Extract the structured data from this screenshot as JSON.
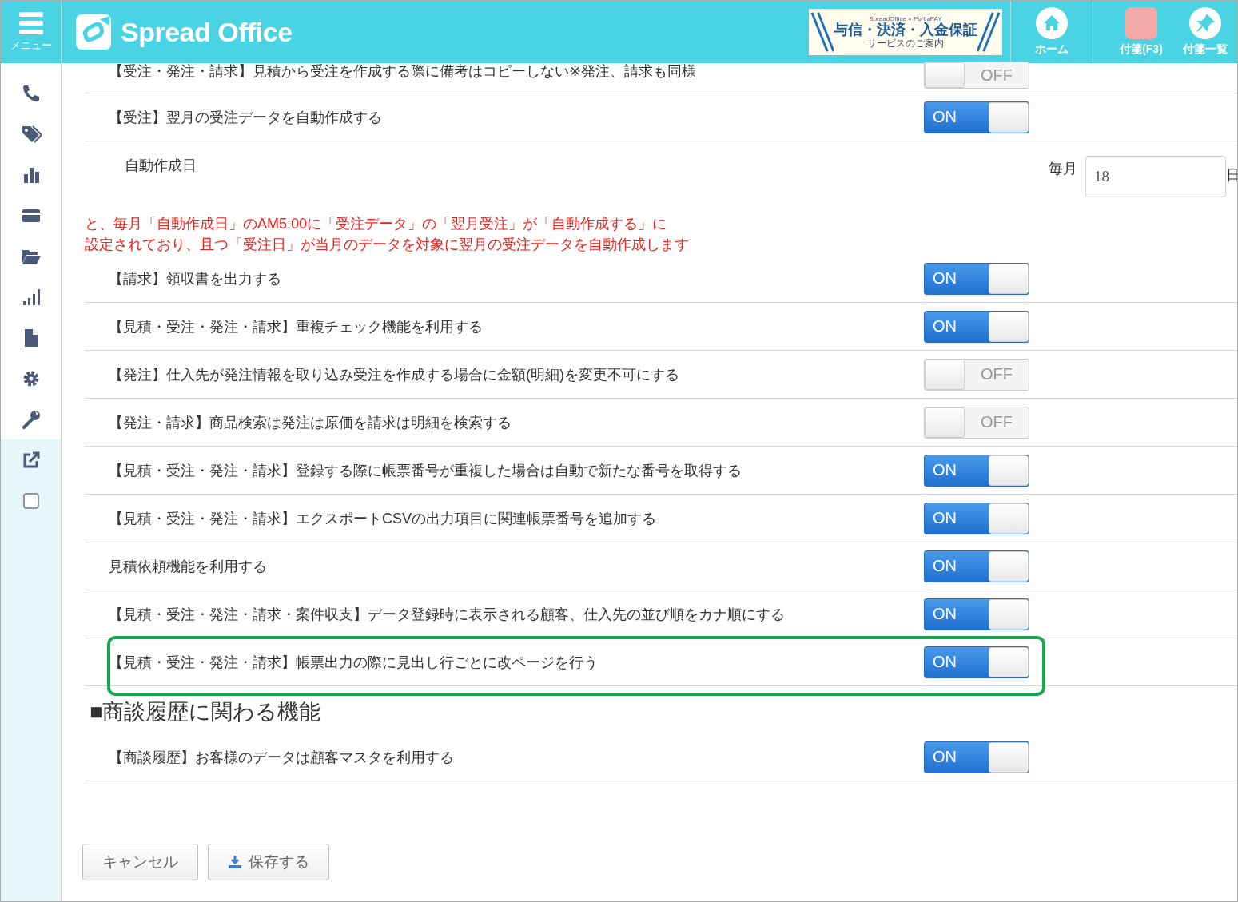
{
  "header": {
    "menu_label": "メニュー",
    "logo_text": "Spread Office",
    "banner": {
      "brands": "SpreadOffice × PortiaPAY",
      "title": "与信・決済・入金保証",
      "subtitle": "サービスのご案内"
    },
    "home_label": "ホーム",
    "sticky_label": "付箋(F3)",
    "sticky_list_label": "付箋一覧"
  },
  "settings": [
    {
      "kind": "toggle",
      "label": "【受注・発注・請求】見積から受注を作成する際に備考はコピーしない※発注、請求も同様",
      "on": false,
      "text": "OFF",
      "highlighted": false,
      "cut": true
    },
    {
      "kind": "toggle",
      "label": "【受注】翌月の受注データを自動作成する",
      "on": true,
      "text": "ON",
      "highlighted": false
    },
    {
      "kind": "date",
      "label": "自動作成日",
      "prefix": "毎月",
      "value": "18",
      "suffix": "日"
    },
    {
      "kind": "note",
      "lines": [
        "と、毎月「自動作成日」のAM5:00に「受注データ」の「翌月受注」が「自動作成する」に",
        "設定されており、且つ「受注日」が当月のデータを対象に翌月の受注データを自動作成します"
      ]
    },
    {
      "kind": "toggle",
      "label": "【請求】領収書を出力する",
      "on": true,
      "text": "ON",
      "highlighted": false
    },
    {
      "kind": "toggle",
      "label": "【見積・受注・発注・請求】重複チェック機能を利用する",
      "on": true,
      "text": "ON",
      "highlighted": false
    },
    {
      "kind": "toggle",
      "label": "【発注】仕入先が発注情報を取り込み受注を作成する場合に金額(明細)を変更不可にする",
      "on": false,
      "text": "OFF",
      "highlighted": false
    },
    {
      "kind": "toggle",
      "label": "【発注・請求】商品検索は発注は原価を請求は明細を検索する",
      "on": false,
      "text": "OFF",
      "highlighted": false
    },
    {
      "kind": "toggle",
      "label": "【見積・受注・発注・請求】登録する際に帳票番号が重複した場合は自動で新たな番号を取得する",
      "on": true,
      "text": "ON",
      "highlighted": false
    },
    {
      "kind": "toggle",
      "label": "【見積・受注・発注・請求】エクスポートCSVの出力項目に関連帳票番号を追加する",
      "on": true,
      "text": "ON",
      "highlighted": false
    },
    {
      "kind": "toggle",
      "label": "見積依頼機能を利用する",
      "on": true,
      "text": "ON",
      "highlighted": false
    },
    {
      "kind": "toggle",
      "label": "【見積・受注・発注・請求・案件収支】データ登録時に表示される顧客、仕入先の並び順をカナ順にする",
      "on": true,
      "text": "ON",
      "highlighted": false
    },
    {
      "kind": "toggle",
      "label": "【見積・受注・発注・請求】帳票出力の際に見出し行ごとに改ページを行う",
      "on": true,
      "text": "ON",
      "highlighted": true
    },
    {
      "kind": "heading",
      "text": "■商談履歴に関わる機能"
    },
    {
      "kind": "toggle",
      "label": "【商談履歴】お客様のデータは顧客マスタを利用する",
      "on": true,
      "text": "ON",
      "highlighted": false
    }
  ],
  "buttons": [
    {
      "kind": "cancel",
      "label": "キャンセル"
    },
    {
      "kind": "save",
      "label": "保存する"
    }
  ]
}
